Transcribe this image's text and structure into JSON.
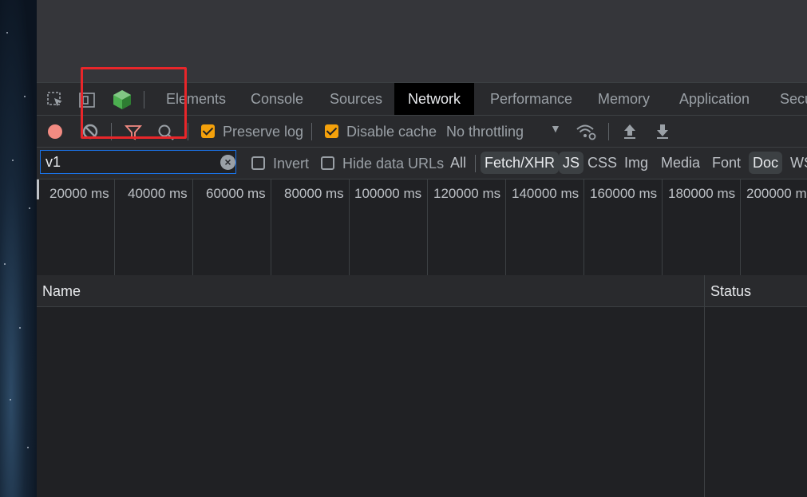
{
  "devtools": {
    "tabs": [
      "Elements",
      "Console",
      "Sources",
      "Network",
      "Performance",
      "Memory",
      "Application",
      "Secu"
    ],
    "active_tab": "Network",
    "toolbar": {
      "preserve_log": "Preserve log",
      "preserve_log_checked": true,
      "disable_cache": "Disable cache",
      "disable_cache_checked": true,
      "throttling": "No throttling"
    },
    "filter": {
      "value": "v1",
      "invert": "Invert",
      "hide_data_urls": "Hide data URLs",
      "types": [
        "All",
        "Fetch/XHR",
        "JS",
        "CSS",
        "Img",
        "Media",
        "Font",
        "Doc",
        "WS"
      ],
      "selected_types": [
        "Fetch/XHR",
        "JS",
        "Doc"
      ]
    },
    "overview": {
      "ticks": [
        "20000 ms",
        "40000 ms",
        "60000 ms",
        "80000 ms",
        "100000 ms",
        "120000 ms",
        "140000 ms",
        "160000 ms",
        "180000 ms",
        "200000 m"
      ]
    },
    "columns": [
      "Name",
      "Status"
    ]
  },
  "colors": {
    "annotation": "#e8262a",
    "checkbox": "#f4a10b",
    "record": "#f28b82",
    "vue_icon": "#4caf50"
  }
}
